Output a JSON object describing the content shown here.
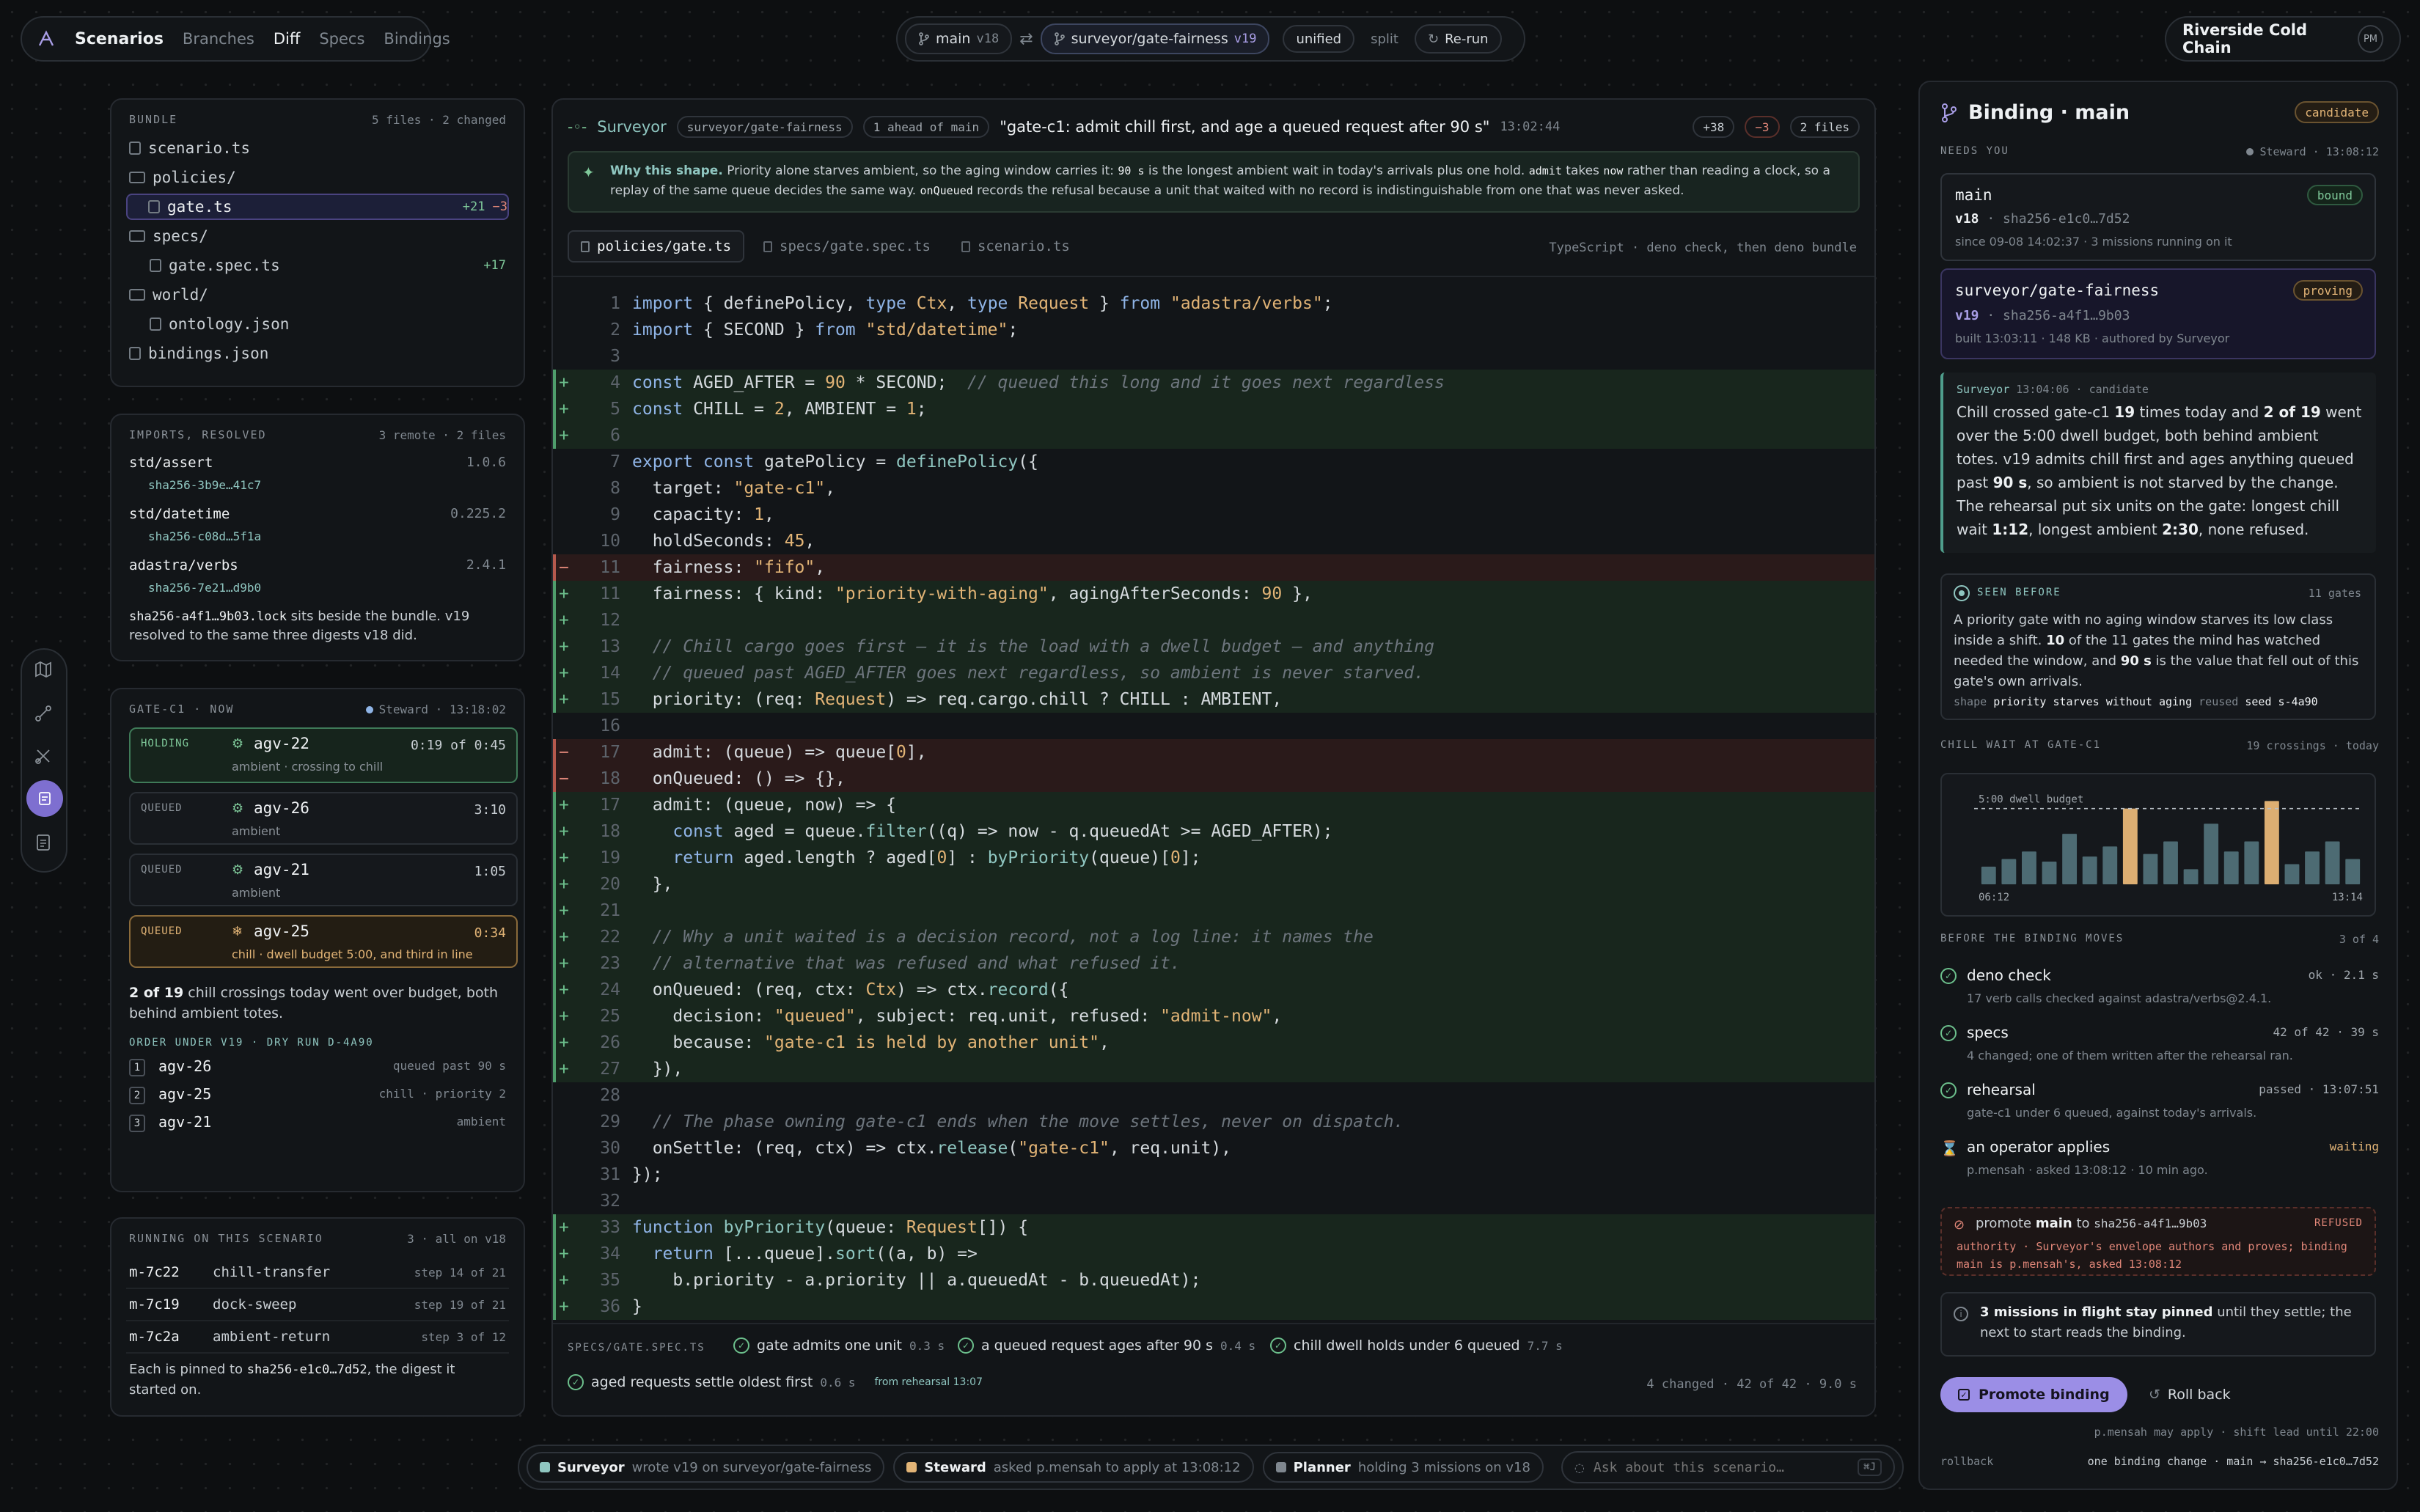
{
  "topnav": {
    "brand": "Scenarios",
    "items": [
      "Branches",
      "Diff",
      "Specs",
      "Bindings"
    ],
    "active": "Diff",
    "branch_main": "main",
    "branch_main_ver": "v18",
    "branch_other": "surveyor/gate-fairness",
    "branch_other_ver": "v19",
    "view_unified": "unified",
    "view_split": "split",
    "rerun": "Re-run",
    "org": "Riverside Cold Chain",
    "avatar": "PM"
  },
  "bundle": {
    "title": "BUNDLE",
    "meta": "5 files · 2 changed",
    "files": [
      {
        "name": "scenario.ts",
        "kind": "file",
        "indent": 0
      },
      {
        "name": "policies/",
        "kind": "folder",
        "indent": 0
      },
      {
        "name": "gate.ts",
        "kind": "file",
        "indent": 1,
        "selected": true,
        "add": "+21",
        "del": "−3"
      },
      {
        "name": "specs/",
        "kind": "folder",
        "indent": 0
      },
      {
        "name": "gate.spec.ts",
        "kind": "file",
        "indent": 1,
        "add": "+17"
      },
      {
        "name": "world/",
        "kind": "folder",
        "indent": 0
      },
      {
        "name": "ontology.json",
        "kind": "file",
        "indent": 1
      },
      {
        "name": "bindings.json",
        "kind": "file",
        "indent": 0
      }
    ]
  },
  "imports": {
    "title": "IMPORTS, RESOLVED",
    "meta": "3 remote · 2 files",
    "items": [
      {
        "name": "std/assert",
        "ver": "1.0.6",
        "hash": "sha256-3b9e…41c7"
      },
      {
        "name": "std/datetime",
        "ver": "0.225.2",
        "hash": "sha256-c08d…5f1a"
      },
      {
        "name": "adastra/verbs",
        "ver": "2.4.1",
        "hash": "sha256-7e21…d9b0"
      }
    ],
    "note_hash": "sha256-a4f1…9b03.lock",
    "note_text": " sits beside the bundle. v19 resolved to the same three digests v18 did."
  },
  "gate": {
    "title": "GATE-C1 · NOW",
    "steward": "Steward · 13:18:02",
    "cards": [
      {
        "state": "HOLDING",
        "unit": "agv-22",
        "time": "0:19 of 0:45",
        "sub": "ambient · crossing to chill"
      },
      {
        "state": "QUEUED",
        "unit": "agv-26",
        "time": "3:10",
        "sub": "ambient"
      },
      {
        "state": "QUEUED",
        "unit": "agv-21",
        "time": "1:05",
        "sub": "ambient"
      },
      {
        "state": "QUEUED",
        "unit": "agv-25",
        "time": "0:34",
        "sub": "chill · dwell budget 5:00, and third in line"
      }
    ],
    "summary_bold": "2 of 19",
    "summary_text": " chill crossings today went over budget, both behind ambient totes.",
    "order_title": "ORDER UNDER V19 · DRY RUN D-4A90",
    "order": [
      {
        "n": "1",
        "unit": "agv-26",
        "note": "queued past 90 s"
      },
      {
        "n": "2",
        "unit": "agv-25",
        "note": "chill · priority 2"
      },
      {
        "n": "3",
        "unit": "agv-21",
        "note": "ambient"
      }
    ]
  },
  "running": {
    "title": "RUNNING ON THIS SCENARIO",
    "meta": "3 · all on v18",
    "items": [
      {
        "id": "m-7c22",
        "name": "chill-transfer",
        "step": "step 14 of 21"
      },
      {
        "id": "m-7c19",
        "name": "dock-sweep",
        "step": "step 19 of 21"
      },
      {
        "id": "m-7c2a",
        "name": "ambient-return",
        "step": "step 3 of 12"
      }
    ],
    "note_a": "Each is pinned to ",
    "note_hash": "sha256-e1c0…7d52",
    "note_b": ", the digest it started on."
  },
  "diff": {
    "author": "Surveyor",
    "branch": "surveyor/gate-fairness",
    "ahead": "1 ahead of main",
    "message": "\"gate-c1: admit chill first, and age a queued request after 90 s\"",
    "time": "13:02:44",
    "add": "+38",
    "del": "−3",
    "files": "2 files",
    "why_label": "Why this shape.",
    "why_1": " Priority alone starves ambient, so the aging window carries it: ",
    "why_code1": "90 s",
    "why_2": " is the longest ambient wait in today's arrivals plus one hold. ",
    "why_code2": "admit",
    "why_3": " takes ",
    "why_code3": "now",
    "why_4": " rather than reading a clock, so a replay of the same queue decides the same way. ",
    "why_code4": "onQueued",
    "why_5": " records the refusal because a unit that waited with no record is indistinguishable from one that was never asked.",
    "tabs": [
      "policies/gate.ts",
      "specs/gate.spec.ts",
      "scenario.ts"
    ],
    "lang": "TypeScript · deno check, then deno bundle"
  },
  "specs_footer": {
    "title": "SPECS/GATE.SPEC.TS",
    "items": [
      {
        "name": "gate admits one unit",
        "t": "0.3 s"
      },
      {
        "name": "a queued request ages after 90 s",
        "t": "0.4 s"
      },
      {
        "name": "chill dwell holds under 6 queued",
        "t": "7.7 s"
      },
      {
        "name": "aged requests settle oldest first",
        "t": "0.6 s",
        "extra": "from rehearsal 13:07"
      }
    ],
    "summary": "4 changed · 42 of 42 · 9.0 s"
  },
  "binding": {
    "title": "Binding · main",
    "badge": "candidate",
    "needs_you": "NEEDS YOU",
    "steward": "Steward · 13:08:12",
    "main_name": "main",
    "main_badge": "bound",
    "main_ver": "v18",
    "main_hash": "sha256-e1c0…7d52",
    "main_sub": "since 09-08 14:02:37 · 3 missions running on it",
    "cand_name": "surveyor/gate-fairness",
    "cand_badge": "proving",
    "cand_ver": "v19",
    "cand_hash": "sha256-a4f1…9b03",
    "cand_sub": "built 13:03:11 · 148 KB · authored by Surveyor",
    "msg_author": "Surveyor",
    "msg_meta": "13:04:06 · candidate",
    "msg_1": "Chill crossed gate-c1 ",
    "msg_b1": "19",
    "msg_2": " times today and ",
    "msg_b2": "2 of 19",
    "msg_3": " went over the 5:00 dwell budget, both behind ambient totes. v19 admits chill first and ages anything queued past ",
    "msg_b3": "90 s",
    "msg_4": ", so ambient is not starved by the change. The rehearsal put six units on the gate: longest chill wait ",
    "msg_b4": "1:12",
    "msg_5": ", longest ambient ",
    "msg_b5": "2:30",
    "msg_6": ", none refused.",
    "seen_title": "SEEN BEFORE",
    "seen_meta": "11 gates",
    "seen_1": "A priority gate with no aging window starves its low class inside a shift. ",
    "seen_b1": "10",
    "seen_2": " of the 11 gates the mind has watched needed the window, and ",
    "seen_b2": "90 s",
    "seen_3": " is the value that fell out of this gate's own arrivals.",
    "seen_shape_label": "shape",
    "seen_shape": "priority starves without aging",
    "seen_reused_label": "reused",
    "seen_reused": "seed s-4a90"
  },
  "chart_data": {
    "type": "bar",
    "title": "CHILL WAIT AT GATE-C1",
    "meta": "19 crossings · today",
    "threshold_label": "5:00 dwell budget",
    "x_start": "06:12",
    "x_end": "13:14",
    "threshold": 300,
    "ylim": [
      0,
      360
    ],
    "values": [
      70,
      100,
      130,
      90,
      200,
      110,
      150,
      300,
      120,
      170,
      60,
      240,
      130,
      170,
      330,
      80,
      130,
      170,
      100
    ],
    "over": [
      7,
      14
    ]
  },
  "checks": {
    "title": "BEFORE THE BINDING MOVES",
    "meta": "3 of 4",
    "items": [
      {
        "name": "deno check",
        "status": "ok · 2.1 s",
        "sub": "17 verb calls checked against adastra/verbs@2.4.1."
      },
      {
        "name": "specs",
        "status": "42 of 42 · 39 s",
        "sub": "4 changed; one of them written after the rehearsal ran."
      },
      {
        "name": "rehearsal",
        "status": "passed · 13:07:51",
        "sub": "gate-c1 under 6 queued, against today's arrivals."
      },
      {
        "name": "an operator applies",
        "status": "waiting",
        "sub": "p.mensah · asked 13:08:12 · 10 min ago."
      }
    ]
  },
  "refused": {
    "a": "promote ",
    "b": "main",
    "c": " to ",
    "hash": "sha256-a4f1…9b03",
    "badge": "REFUSED",
    "detail": "authority · Surveyor's envelope authors and proves; binding main is p.mensah's, asked 13:08:12"
  },
  "pinned": {
    "bold": "3 missions in flight stay pinned",
    "text": " until they settle; the next to start reads the binding."
  },
  "actions": {
    "promote": "Promote binding",
    "rollback": "Roll back",
    "may_apply": "p.mensah may apply · shift lead until 22:00",
    "rb_label": "rollback",
    "rb_text": "one binding change · main → sha256-e1c0…7d52"
  },
  "statusbar": {
    "items": [
      {
        "agent": "Surveyor",
        "text": "wrote v19 on surveyor/gate-fairness",
        "color": "#8fc6c0"
      },
      {
        "agent": "Steward",
        "text": "asked p.mensah to apply at 13:08:12",
        "color": "#e2b476"
      },
      {
        "agent": "Planner",
        "text": "holding 3 missions on v18",
        "color": "#7f878f"
      }
    ],
    "ask_placeholder": "Ask about this scenario…",
    "shortcut": "⌘J"
  }
}
